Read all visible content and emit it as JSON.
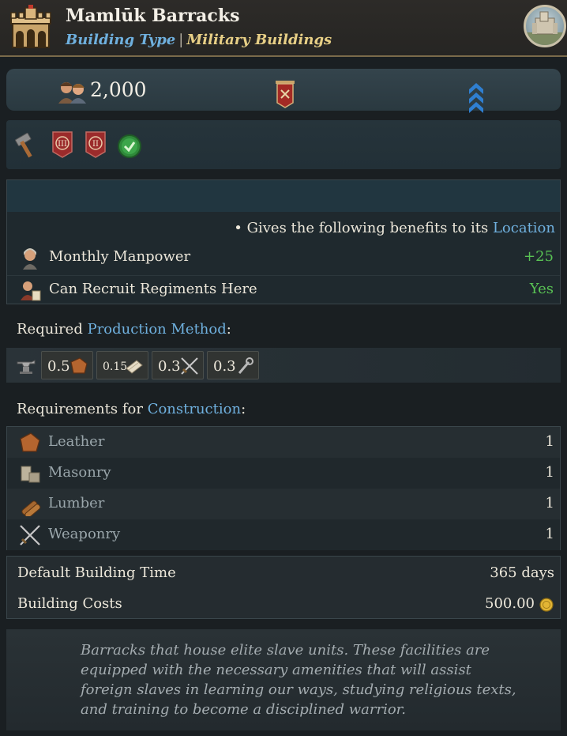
{
  "header": {
    "title": "Mamlūk Barracks",
    "building_type_label": "Building Type",
    "separator": "|",
    "category": "Military Buildings",
    "icons": {
      "building": "fortress-icon",
      "portrait": "castle-portrait-icon"
    }
  },
  "stats": {
    "manpower_value": "2,000",
    "icons": [
      "people-icon",
      "red-banner-icon",
      "blue-chevron-rank-icon"
    ]
  },
  "tags": {
    "icons": [
      "hammer-icon",
      "roman-iii-badge-icon",
      "roman-ii-badge-icon",
      "green-check-icon"
    ],
    "badge_iii": "III",
    "badge_ii": "II"
  },
  "benefits": {
    "intro": "• Gives the following benefits to its",
    "location_link": "Location",
    "rows": [
      {
        "label": "Monthly Manpower",
        "value": "+25",
        "icon": "soldier-portrait-icon"
      },
      {
        "label": "Can Recruit Regiments Here",
        "value": "Yes",
        "icon": "recruit-scroll-icon"
      }
    ],
    "value_color": "#59c254"
  },
  "production": {
    "label_prefix": "Required",
    "label_link": "Production Method",
    "label_suffix": ":",
    "lead_icon": "anvil-icon",
    "goods": [
      {
        "amount": "0.5",
        "icon": "leather-icon"
      },
      {
        "amount": "0.15",
        "icon": "paper-icon"
      },
      {
        "amount": "0.3",
        "icon": "weaponry-icon"
      },
      {
        "amount": "0.3",
        "icon": "tools-icon"
      }
    ]
  },
  "construction": {
    "label_prefix": "Requirements for",
    "label_link": "Construction",
    "label_suffix": ":",
    "rows": [
      {
        "label": "Leather",
        "qty": "1",
        "icon": "leather-icon"
      },
      {
        "label": "Masonry",
        "qty": "1",
        "icon": "masonry-icon"
      },
      {
        "label": "Lumber",
        "qty": "1",
        "icon": "lumber-icon"
      },
      {
        "label": "Weaponry",
        "qty": "1",
        "icon": "weaponry-icon"
      }
    ]
  },
  "cost": {
    "time_label": "Default Building Time",
    "time_value": "365 days",
    "cost_label": "Building Costs",
    "cost_value": "500.00",
    "coin_icon": "gold-coin-icon"
  },
  "description": "Barracks that house elite slave units. These facilities are equipped with the necessary amenities that will assist foreign slaves in learning our ways, studying religious texts, and training to become a disciplined warrior.",
  "colors": {
    "link": "#6fb0de",
    "category": "#e7cf86",
    "positive": "#59c254",
    "accent_border": "#7a6a4a"
  }
}
